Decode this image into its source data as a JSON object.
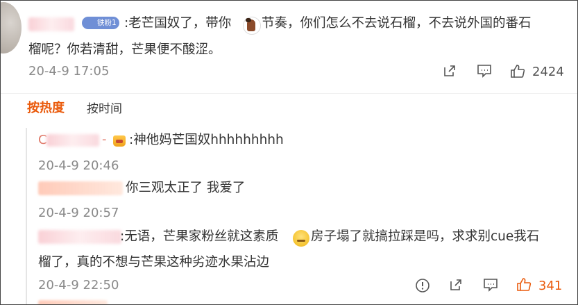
{
  "comment": {
    "text_line1": ":老芒国奴了，带你",
    "text_line1b": "节奏，你们怎么不去说石榴，不去说外国的番石",
    "text_line2": "榴呢？你若清甜，芒果便不酸涩。",
    "badge": "铁粉1",
    "timestamp": "20-4-9 17:05",
    "like_count": "2424"
  },
  "sort": {
    "by_heat": "按热度",
    "by_time": "按时间"
  },
  "replies": [
    {
      "text": ":神他妈芒国奴hhhhhhhhh",
      "timestamp": "20-4-9 20:46"
    },
    {
      "text": "你三观太正了 我爱了",
      "timestamp": "20-4-9 20:57"
    },
    {
      "text_line1a": ":无语，芒果家粉丝就这素质",
      "text_line1b": "房子塌了就搞拉踩是吗，求求别cue我石",
      "text_line2": "榴了，真的不想与芒果这种劣迹水果沾边",
      "timestamp": "20-4-9 22:50",
      "like_count": "341"
    }
  ],
  "colors": {
    "accent_orange": "#ea5a0b",
    "text": "#333333",
    "muted": "#8a8a8a",
    "badge_blue": "#6f8fd6"
  },
  "icons": [
    "share-icon",
    "comment-icon",
    "like-icon",
    "report-icon",
    "crown-icon",
    "horse-emoji-icon",
    "face-emoji-icon"
  ]
}
